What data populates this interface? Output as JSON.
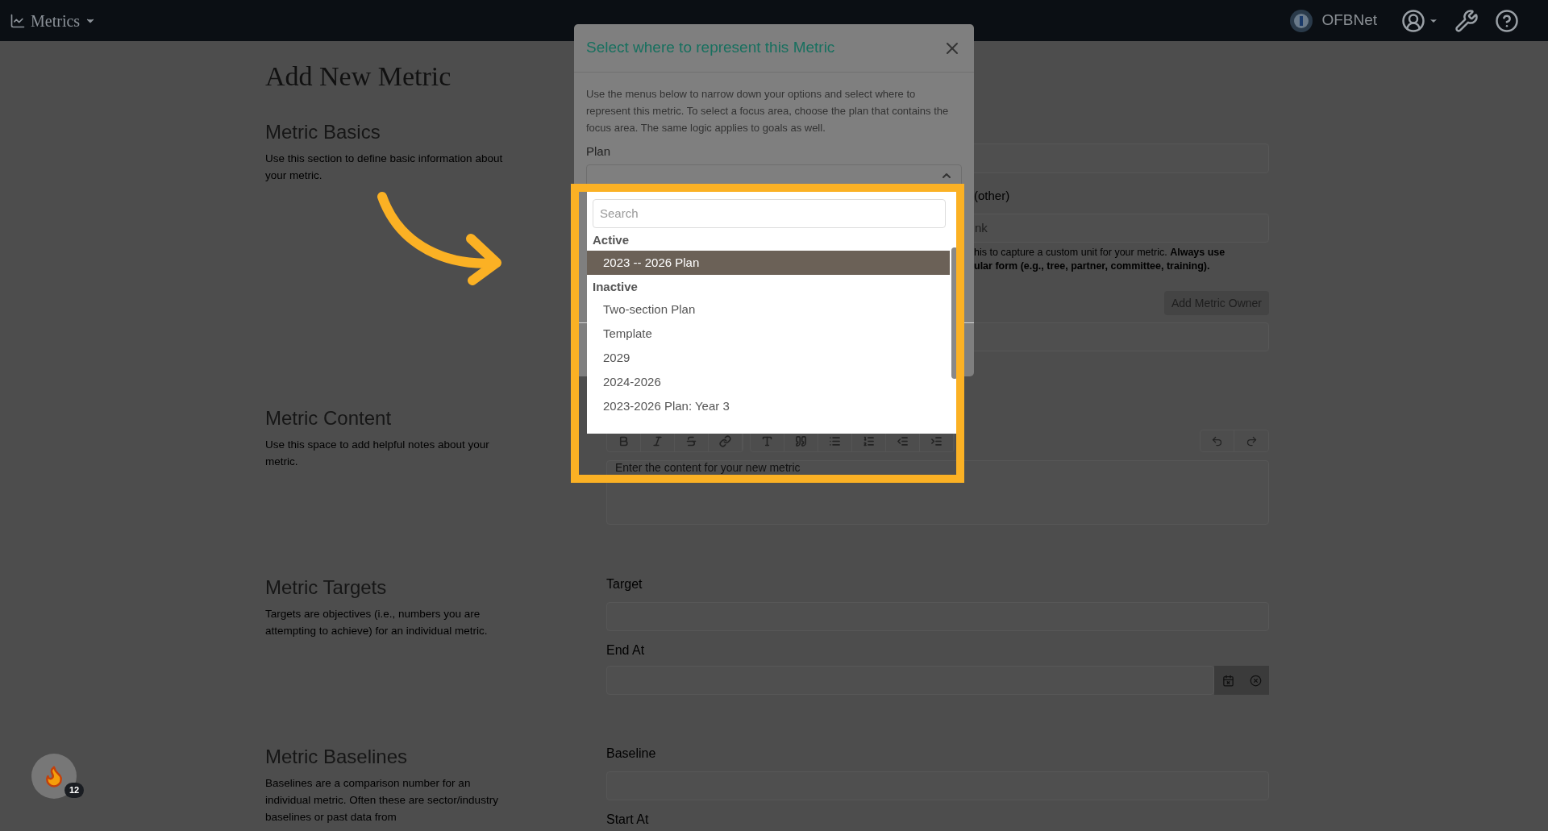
{
  "top_bar": {
    "title": "Metrics",
    "org": "OFBNet"
  },
  "page_title": "Add New Metric",
  "basics": {
    "heading": "Metric Basics",
    "description": "Use this section to define basic information about your metric.",
    "other_label": "(other)",
    "unit_value": "nk",
    "help_lines": [
      "his to capture a custom unit for your metric. **Always use**",
      "**ular form (e.g., tree, partner, committee, training).**"
    ],
    "owner_button": "Add Metric Owner"
  },
  "content": {
    "heading": "Metric Content",
    "description": "Use this space to add helpful notes about your metric.",
    "editor_placeholder": "Enter the content for your new metric"
  },
  "targets": {
    "heading": "Metric Targets",
    "description": "Targets are objectives (i.e., numbers you are attempting to achieve) for an individual metric.",
    "fields": [
      {
        "label": "Target",
        "kind": "text"
      },
      {
        "label": "End At",
        "kind": "date"
      }
    ]
  },
  "baselines": {
    "heading": "Metric Baselines",
    "description": "Baselines are a comparison number for an individual metric. Often these are sector/industry baselines or past data from",
    "fields": [
      {
        "label": "Baseline",
        "kind": "text"
      },
      {
        "label": "Start At",
        "kind": "label"
      }
    ]
  },
  "modal": {
    "title": "Select where to represent this Metric",
    "description": "Use the menus below to narrow down your options and select where to represent this metric. To select a focus area, choose the plan that contains the focus area. The same logic applies to goals as well.",
    "plan_label": "Plan",
    "dropdown": {
      "search_placeholder": "Search",
      "groups": [
        {
          "label": "Active",
          "options": [
            {
              "label": "2023 -- 2026 Plan",
              "selected": true
            }
          ]
        },
        {
          "label": "Inactive",
          "options": [
            {
              "label": "Two-section Plan",
              "selected": false
            },
            {
              "label": "Template",
              "selected": false
            },
            {
              "label": "2029",
              "selected": false
            },
            {
              "label": "2024-2026",
              "selected": false
            },
            {
              "label": "2023-2026 Plan: Year 3",
              "selected": false
            }
          ]
        }
      ]
    }
  },
  "notification_badge": "12"
}
